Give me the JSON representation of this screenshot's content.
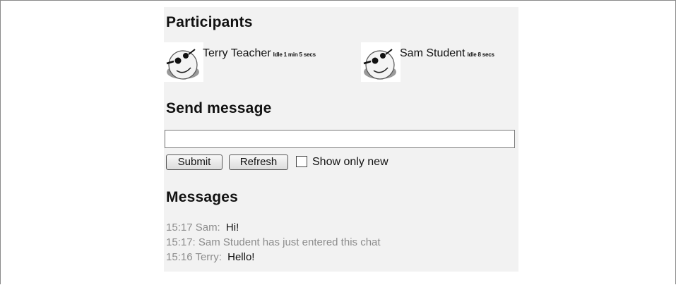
{
  "participants": {
    "heading": "Participants",
    "list": [
      {
        "name": "Terry Teacher",
        "idle": "Idle 1 min 5 secs",
        "avatar_icon": "smiley-avatar-icon"
      },
      {
        "name": "Sam Student",
        "idle": "Idle 8 secs",
        "avatar_icon": "smiley-avatar-icon"
      }
    ]
  },
  "send": {
    "heading": "Send message",
    "input_value": "",
    "submit_label": "Submit",
    "refresh_label": "Refresh",
    "show_only_new_label": "Show only new",
    "show_only_new_checked": false
  },
  "messages": {
    "heading": "Messages",
    "items": [
      {
        "time": "15:17",
        "author": "Sam:",
        "text": "Hi!"
      },
      {
        "time": "15:17:",
        "system": "Sam Student has just entered this chat"
      },
      {
        "time": "15:16",
        "author": "Terry:",
        "text": "Hello!"
      }
    ]
  },
  "colors": {
    "panel_bg": "#f2f2f2",
    "meta_text": "#8c8c8c",
    "main_text": "#111111"
  }
}
